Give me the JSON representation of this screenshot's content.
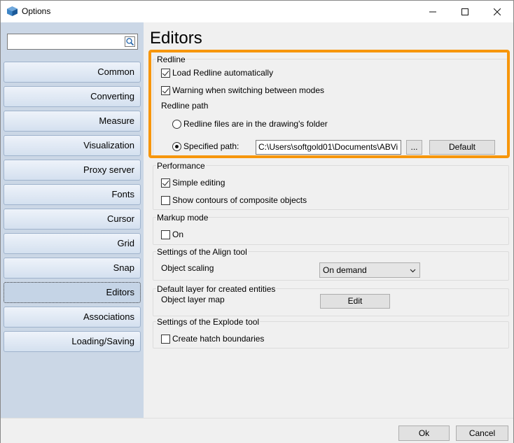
{
  "window": {
    "title": "Options"
  },
  "search": {
    "value": ""
  },
  "sidebar": {
    "items": [
      {
        "label": "Common"
      },
      {
        "label": "Converting"
      },
      {
        "label": "Measure"
      },
      {
        "label": "Visualization"
      },
      {
        "label": "Proxy server"
      },
      {
        "label": "Fonts"
      },
      {
        "label": "Cursor"
      },
      {
        "label": "Grid"
      },
      {
        "label": "Snap"
      },
      {
        "label": "Editors",
        "selected": true
      },
      {
        "label": "Associations"
      },
      {
        "label": "Loading/Saving"
      }
    ]
  },
  "page": {
    "title": "Editors"
  },
  "redline": {
    "group_title": "Redline",
    "load_auto": {
      "label": "Load Redline automatically",
      "checked": true
    },
    "warning_switch": {
      "label": "Warning when switching between modes",
      "checked": true
    },
    "path_label": "Redline path",
    "radio_drawing_folder": {
      "label": "Redline files are in the drawing's folder",
      "checked": false
    },
    "radio_specified": {
      "label": "Specified path:",
      "checked": true
    },
    "path_value": "C:\\Users\\softgold01\\Documents\\ABVi",
    "browse_label": "...",
    "default_label": "Default",
    "highlight_color": "#f7960c"
  },
  "performance": {
    "group_title": "Performance",
    "simple_editing": {
      "label": "Simple editing",
      "checked": true
    },
    "show_contours": {
      "label": "Show contours of composite objects",
      "checked": false
    }
  },
  "markup": {
    "group_title": "Markup mode",
    "on": {
      "label": "On",
      "checked": false
    }
  },
  "align": {
    "group_title": "Settings of the Align tool",
    "scaling_label": "Object scaling",
    "scaling_value": "On demand"
  },
  "default_layer": {
    "group_title": "Default layer for created entities",
    "layer_map_label": "Object layer map",
    "edit_label": "Edit"
  },
  "explode": {
    "group_title": "Settings of the Explode tool",
    "hatch": {
      "label": "Create hatch boundaries",
      "checked": false
    }
  },
  "footer": {
    "ok_label": "Ok",
    "cancel_label": "Cancel"
  }
}
